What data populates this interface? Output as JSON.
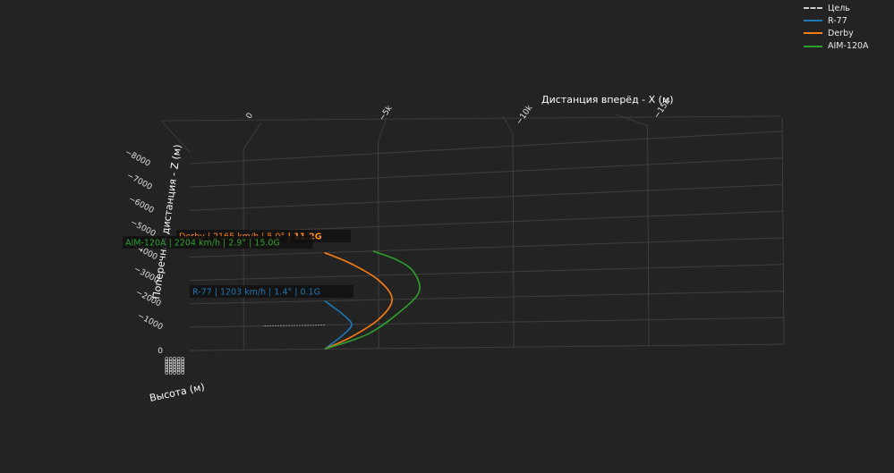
{
  "chart_data": {
    "type": "line",
    "scene": "3d",
    "axes": {
      "x": {
        "title": "Дистанция вперёд - X (м)",
        "ticks": [
          "0",
          "−5k",
          "−10k",
          "−15k"
        ],
        "range": [
          2000,
          -20000
        ]
      },
      "y": {
        "title": "Поперечная дистанция - Z (м)",
        "ticks": [
          "0",
          "−1000",
          "−2000",
          "−3000",
          "−4000",
          "−5000",
          "−6000",
          "−7000",
          "−8000"
        ],
        "range": [
          0,
          -8500
        ]
      },
      "z": {
        "title": "Высота (м)"
      }
    },
    "series": [
      {
        "name": "Цель",
        "color": "#cccccc",
        "dash": true,
        "x": [
          -3000,
          -700
        ],
        "y": [
          -1000,
          -1000
        ]
      },
      {
        "name": "R-77",
        "color": "#1f77b4",
        "x": [
          -3000,
          -3300,
          -3700,
          -4000,
          -3700,
          -3300,
          -3000
        ],
        "y": [
          0,
          -250,
          -600,
          -1000,
          -1400,
          -1750,
          -2000
        ]
      },
      {
        "name": "Derby",
        "color": "#ff7f0e",
        "x": [
          -3000,
          -4000,
          -5000,
          -5500,
          -5000,
          -4000,
          -3000
        ],
        "y": [
          0,
          -500,
          -1200,
          -2000,
          -2800,
          -3500,
          -4000
        ]
      },
      {
        "name": "AIM-120A",
        "color": "#2ca02c",
        "x": [
          -3000,
          -4600,
          -5800,
          -6500,
          -6300,
          -5700,
          -4800
        ],
        "y": [
          0,
          -600,
          -1500,
          -2300,
          -3100,
          -3600,
          -4000
        ]
      }
    ],
    "annotations": [
      {
        "series": "Derby",
        "text": "Derby | 2165 km/h | 5.0°",
        "highlight": "| 11.2G",
        "color": "#ff7f0e",
        "highlight_color": "#ff8c1a"
      },
      {
        "series": "AIM-120A",
        "text": "AIM-120A | 2204 km/h | 2.9° | 15.0G",
        "color": "#2ca02c"
      },
      {
        "series": "R-77",
        "text": "R-77 | 1203 km/h | 1.4° | 0.1G",
        "color": "#1f77b4"
      }
    ],
    "legend_position": "top-right",
    "grid": true
  }
}
